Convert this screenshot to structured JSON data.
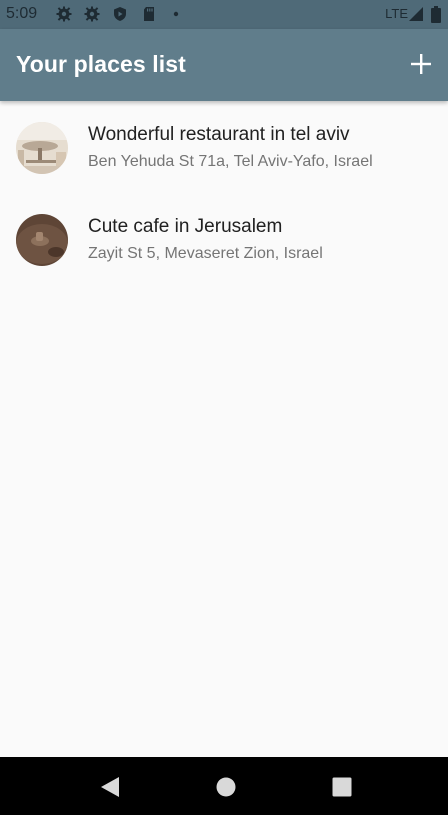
{
  "status_bar": {
    "time": "5:09",
    "network": "LTE",
    "icons": [
      "gear-icon",
      "gear-icon",
      "shield-icon",
      "sd-card-icon",
      "dot-icon",
      "signal-icon",
      "battery-icon"
    ]
  },
  "app_bar": {
    "title": "Your places list",
    "add_icon": "plus-icon"
  },
  "places": [
    {
      "title": "Wonderful restaurant in tel aviv",
      "address": "Ben Yehuda St 71a, Tel Aviv-Yafo, Israel"
    },
    {
      "title": "Cute cafe in Jerusalem",
      "address": "Zayit St 5, Mevaseret Zion, Israel"
    }
  ],
  "nav_bar": {
    "buttons": [
      "back-icon",
      "home-icon",
      "recents-icon"
    ]
  },
  "colors": {
    "status_bar": "#4f6a78",
    "app_bar": "#607d8b",
    "background": "#fafafa",
    "title_text": "#212121",
    "subtitle_text": "#757575"
  }
}
